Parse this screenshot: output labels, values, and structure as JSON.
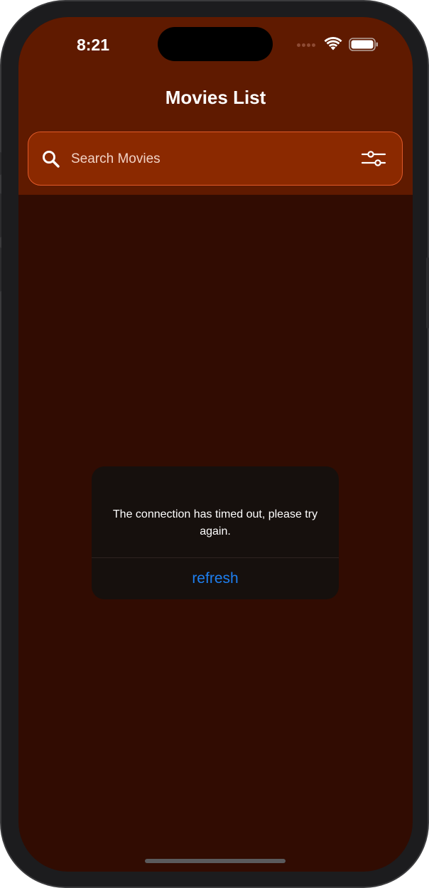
{
  "status_bar": {
    "time": "8:21",
    "icons": [
      "cellular-signal-icon",
      "wifi-icon",
      "battery-icon"
    ]
  },
  "header": {
    "title": "Movies List"
  },
  "search": {
    "placeholder": "Search Movies",
    "value": "",
    "icon": "search-icon",
    "filter_icon": "sliders-filter-icon"
  },
  "dialog": {
    "message": "The connection has timed out, please try again.",
    "action_label": "refresh"
  },
  "colors": {
    "header_bg": "#5f1a00",
    "body_bg": "#310c02",
    "search_bg": "#8b2900",
    "search_border": "#e05a2a",
    "dialog_bg": "#16100d",
    "action_blue": "#1e7ff0"
  }
}
